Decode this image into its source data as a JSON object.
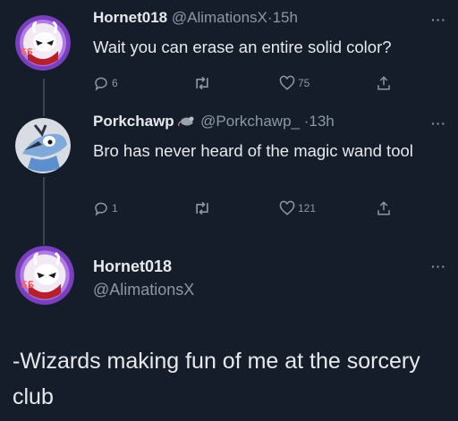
{
  "tweets": [
    {
      "name": "Hornet018",
      "handle": "@AlimationsX",
      "separator": "·",
      "time": "15h",
      "text": "Wait you can erase an entire solid color?",
      "replies": "6",
      "retweets": "",
      "likes": "75",
      "avatar_icon": "hornet-avatar-icon"
    },
    {
      "name": "Porkchawp",
      "handle": "@Porkchawp_",
      "separator": "·",
      "time": "13h",
      "text": "Bro has never heard of the magic wand tool",
      "replies": "1",
      "retweets": "",
      "likes": "121",
      "avatar_icon": "mordecai-avatar-icon",
      "name_emoji_icon": "rat-emoji-icon"
    }
  ],
  "main_tweet": {
    "name": "Hornet018",
    "handle": "@AlimationsX",
    "text": "-Wizards making fun of me at the sorcery club",
    "avatar_icon": "hornet-avatar-icon"
  },
  "more_label": "···",
  "colors": {
    "background": "#151d2b",
    "text": "#e7e9ea",
    "secondary": "#8b98a5",
    "avatar_ring": "#8d4fd1",
    "thread_line": "#3a4452"
  }
}
